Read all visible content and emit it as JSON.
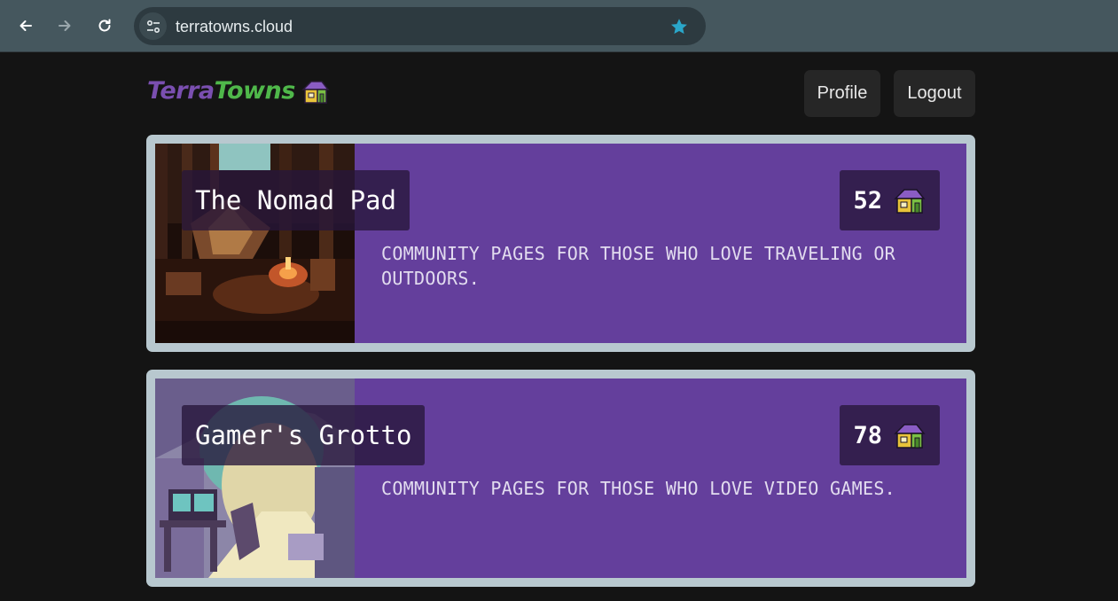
{
  "browser": {
    "url": "terratowns.cloud",
    "accent_color": "#2aa6c9"
  },
  "header": {
    "logo_part1": "Terra",
    "logo_part2": "Towns",
    "logo_icon": "house-icon",
    "profile_label": "Profile",
    "logout_label": "Logout"
  },
  "towns": [
    {
      "name": "The Nomad Pad",
      "visits": "52",
      "description": "COMMUNITY PAGES FOR THOSE WHO LOVE TRAVELING OR OUTDOORS.",
      "image": "campfire-forest-image"
    },
    {
      "name": "Gamer's Grotto",
      "visits": "78",
      "description": "COMMUNITY PAGES FOR THOSE WHO LOVE VIDEO GAMES.",
      "image": "cave-gaming-setup-image"
    }
  ],
  "colors": {
    "card_border": "#b8c8cf",
    "card_background": "#643f9c",
    "page_background": "#141414"
  }
}
